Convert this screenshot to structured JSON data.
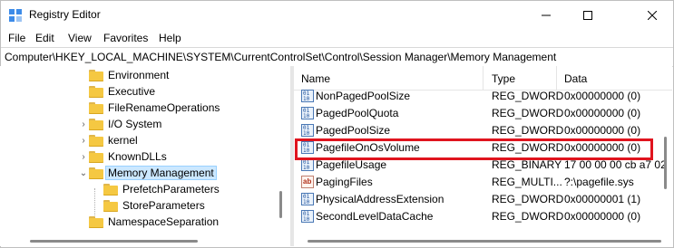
{
  "window": {
    "title": "Registry Editor"
  },
  "menu": [
    "File",
    "Edit",
    "View",
    "Favorites",
    "Help"
  ],
  "address": "Computer\\HKEY_LOCAL_MACHINE\\SYSTEM\\CurrentControlSet\\Control\\Session Manager\\Memory Management",
  "tree": {
    "nodes": [
      {
        "label": "Environment",
        "expander": ""
      },
      {
        "label": "Executive",
        "expander": ""
      },
      {
        "label": "FileRenameOperations",
        "expander": ""
      },
      {
        "label": "I/O System",
        "expander": ">"
      },
      {
        "label": "kernel",
        "expander": ">"
      },
      {
        "label": "KnownDLLs",
        "expander": ">"
      },
      {
        "label": "Memory Management",
        "expander": "v",
        "selected": true
      },
      {
        "label": "PrefetchParameters",
        "expander": ""
      },
      {
        "label": "StoreParameters",
        "expander": ""
      },
      {
        "label": "NamespaceSeparation",
        "expander": ""
      }
    ]
  },
  "list": {
    "columns": {
      "name": "Name",
      "type": "Type",
      "data": "Data"
    },
    "rows": [
      {
        "name": "NonPagedPoolSize",
        "type": "REG_DWORD",
        "data": "0x00000000 (0)",
        "icon": "binary-value-icon"
      },
      {
        "name": "PagedPoolQuota",
        "type": "REG_DWORD",
        "data": "0x00000000 (0)",
        "icon": "binary-value-icon"
      },
      {
        "name": "PagedPoolSize",
        "type": "REG_DWORD",
        "data": "0x00000000 (0)",
        "icon": "binary-value-icon"
      },
      {
        "name": "PagefileOnOsVolume",
        "type": "REG_DWORD",
        "data": "0x00000000 (0)",
        "icon": "binary-value-icon",
        "highlighted": true
      },
      {
        "name": "PagefileUsage",
        "type": "REG_BINARY",
        "data": "17 00 00 00 cb a7 02",
        "icon": "binary-value-icon"
      },
      {
        "name": "PagingFiles",
        "type": "REG_MULTI...",
        "data": "?:\\pagefile.sys",
        "icon": "string-value-icon"
      },
      {
        "name": "PhysicalAddressExtension",
        "type": "REG_DWORD",
        "data": "0x00000001 (1)",
        "icon": "binary-value-icon"
      },
      {
        "name": "SecondLevelDataCache",
        "type": "REG_DWORD",
        "data": "0x00000000 (0)",
        "icon": "binary-value-icon"
      }
    ]
  },
  "colors": {
    "highlight_border": "#e0141e",
    "selection": "#cce8ff",
    "folder": "#f5c842"
  }
}
